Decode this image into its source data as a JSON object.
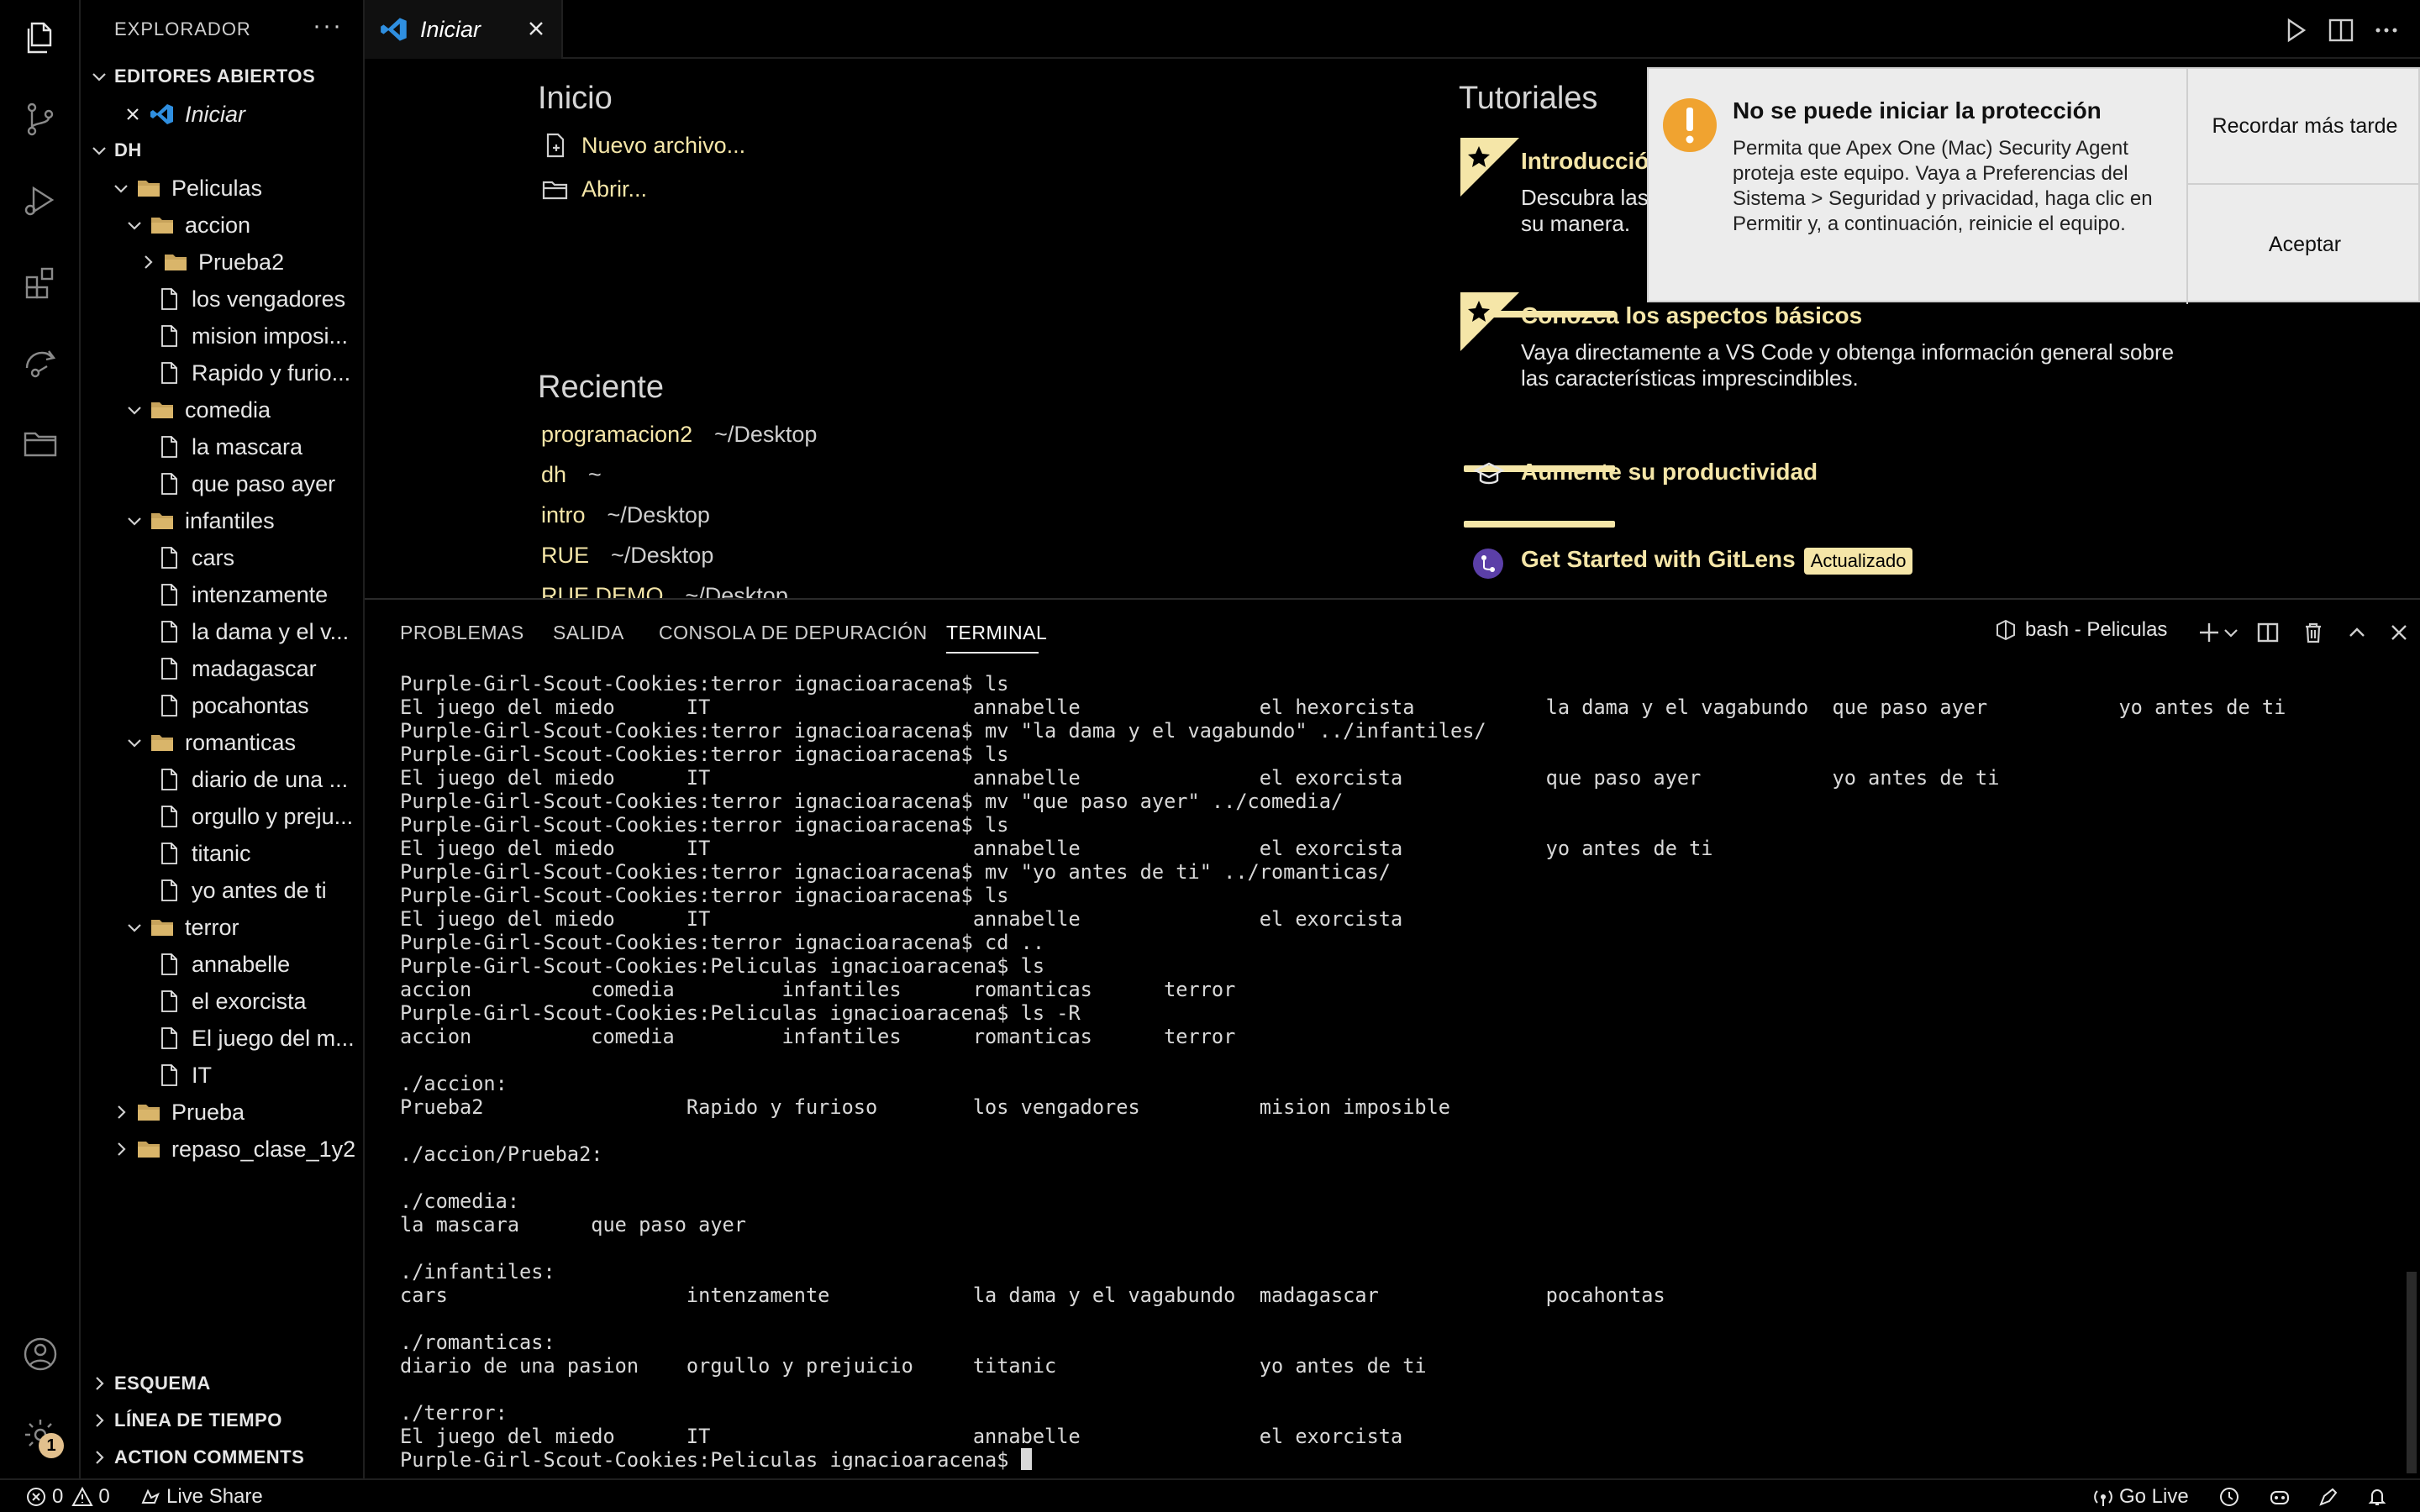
{
  "sidebar": {
    "title": "EXPLORADOR",
    "open_editors": {
      "title": "EDITORES ABIERTOS",
      "item": "Iniciar"
    },
    "workspace": "DH",
    "tree": [
      {
        "label": "Peliculas",
        "kind": "folder",
        "open": true,
        "depth": 0
      },
      {
        "label": "accion",
        "kind": "folder",
        "open": true,
        "depth": 1
      },
      {
        "label": "Prueba2",
        "kind": "folder",
        "open": false,
        "depth": 2
      },
      {
        "label": "los vengadores",
        "kind": "file",
        "depth": 2
      },
      {
        "label": "mision imposi...",
        "kind": "file",
        "depth": 2
      },
      {
        "label": "Rapido y furio...",
        "kind": "file",
        "depth": 2
      },
      {
        "label": "comedia",
        "kind": "folder",
        "open": true,
        "depth": 1
      },
      {
        "label": "la mascara",
        "kind": "file",
        "depth": 2
      },
      {
        "label": "que paso ayer",
        "kind": "file",
        "depth": 2
      },
      {
        "label": "infantiles",
        "kind": "folder",
        "open": true,
        "depth": 1
      },
      {
        "label": "cars",
        "kind": "file",
        "depth": 2
      },
      {
        "label": "intenzamente",
        "kind": "file",
        "depth": 2
      },
      {
        "label": "la dama y el v...",
        "kind": "file",
        "depth": 2
      },
      {
        "label": "madagascar",
        "kind": "file",
        "depth": 2
      },
      {
        "label": "pocahontas",
        "kind": "file",
        "depth": 2
      },
      {
        "label": "romanticas",
        "kind": "folder",
        "open": true,
        "depth": 1
      },
      {
        "label": "diario de una ...",
        "kind": "file",
        "depth": 2
      },
      {
        "label": "orgullo y preju...",
        "kind": "file",
        "depth": 2
      },
      {
        "label": "titanic",
        "kind": "file",
        "depth": 2
      },
      {
        "label": "yo antes de ti",
        "kind": "file",
        "depth": 2
      },
      {
        "label": "terror",
        "kind": "folder",
        "open": true,
        "depth": 1
      },
      {
        "label": "annabelle",
        "kind": "file",
        "depth": 2
      },
      {
        "label": "el exorcista",
        "kind": "file",
        "depth": 2
      },
      {
        "label": "El juego del m...",
        "kind": "file",
        "depth": 2
      },
      {
        "label": "IT",
        "kind": "file",
        "depth": 2
      },
      {
        "label": "Prueba",
        "kind": "folder",
        "open": false,
        "depth": 0
      },
      {
        "label": "repaso_clase_1y2",
        "kind": "folder",
        "open": false,
        "depth": 0
      }
    ],
    "bottom_sections": [
      "ESQUEMA",
      "LÍNEA DE TIEMPO",
      "ACTION COMMENTS"
    ],
    "settings_badge": "1"
  },
  "tab": {
    "label": "Iniciar"
  },
  "welcome": {
    "start_title": "Inicio",
    "new_file": "Nuevo archivo...",
    "open": "Abrir...",
    "recent_title": "Reciente",
    "recent": [
      {
        "name": "programacion2",
        "path": "~/Desktop"
      },
      {
        "name": "dh",
        "path": "~"
      },
      {
        "name": "intro",
        "path": "~/Desktop"
      },
      {
        "name": "RUE",
        "path": "~/Desktop"
      },
      {
        "name": "RUE DEMO",
        "path": "~/Desktop"
      }
    ],
    "tutorials_title": "Tutoriales",
    "tutorials": [
      {
        "title": "Introducción",
        "desc": "Descubra las\nsu manera."
      },
      {
        "title": "Conozca los aspectos básicos",
        "desc": "Vaya directamente a VS Code y obtenga información general sobre\nlas características imprescindibles."
      },
      {
        "title": "Aumente su productividad",
        "desc": ""
      },
      {
        "title": "Get Started with GitLens",
        "badge": "Actualizado",
        "desc": ""
      }
    ]
  },
  "notification": {
    "title": "No se puede iniciar la protección",
    "body": "Permita que Apex One (Mac) Security Agent proteja este equipo. Vaya a Preferencias del Sistema > Seguridad y privacidad, haga clic en Permitir y, a continuación, reinicie el equipo.",
    "remind_later": "Recordar más tarde",
    "accept": "Aceptar"
  },
  "panel": {
    "tabs": [
      "PROBLEMAS",
      "SALIDA",
      "CONSOLA DE DEPURACIÓN",
      "TERMINAL"
    ],
    "active_tab": "TERMINAL",
    "terminal_name": "bash - Peliculas",
    "lines": [
      "Purple-Girl-Scout-Cookies:terror ignacioaracena$ ls",
      "El juego del miedo      IT                      annabelle               el hexorcista           la dama y el vagabundo  que paso ayer           yo antes de ti",
      "Purple-Girl-Scout-Cookies:terror ignacioaracena$ mv \"la dama y el vagabundo\" ../infantiles/",
      "Purple-Girl-Scout-Cookies:terror ignacioaracena$ ls",
      "El juego del miedo      IT                      annabelle               el exorcista            que paso ayer           yo antes de ti",
      "Purple-Girl-Scout-Cookies:terror ignacioaracena$ mv \"que paso ayer\" ../comedia/",
      "Purple-Girl-Scout-Cookies:terror ignacioaracena$ ls",
      "El juego del miedo      IT                      annabelle               el exorcista            yo antes de ti",
      "Purple-Girl-Scout-Cookies:terror ignacioaracena$ mv \"yo antes de ti\" ../romanticas/",
      "Purple-Girl-Scout-Cookies:terror ignacioaracena$ ls",
      "El juego del miedo      IT                      annabelle               el exorcista",
      "Purple-Girl-Scout-Cookies:terror ignacioaracena$ cd ..",
      "Purple-Girl-Scout-Cookies:Peliculas ignacioaracena$ ls",
      "accion          comedia         infantiles      romanticas      terror",
      "Purple-Girl-Scout-Cookies:Peliculas ignacioaracena$ ls -R",
      "accion          comedia         infantiles      romanticas      terror",
      "",
      "./accion:",
      "Prueba2                 Rapido y furioso        los vengadores          mision imposible",
      "",
      "./accion/Prueba2:",
      "",
      "./comedia:",
      "la mascara      que paso ayer",
      "",
      "./infantiles:",
      "cars                    intenzamente            la dama y el vagabundo  madagascar              pocahontas",
      "",
      "./romanticas:",
      "diario de una pasion    orgullo y prejuicio     titanic                 yo antes de ti",
      "",
      "./terror:",
      "El juego del miedo      IT                      annabelle               el exorcista"
    ],
    "prompt": "Purple-Girl-Scout-Cookies:Peliculas ignacioaracena$ "
  },
  "status": {
    "errors": "0",
    "warnings": "0",
    "live_share": "Live Share",
    "go_live": "Go Live"
  },
  "colors": {
    "accent_yellow": "#f5e6a8",
    "folder": "#c7a35b",
    "warning": "#f0a330",
    "background": "#000000"
  }
}
